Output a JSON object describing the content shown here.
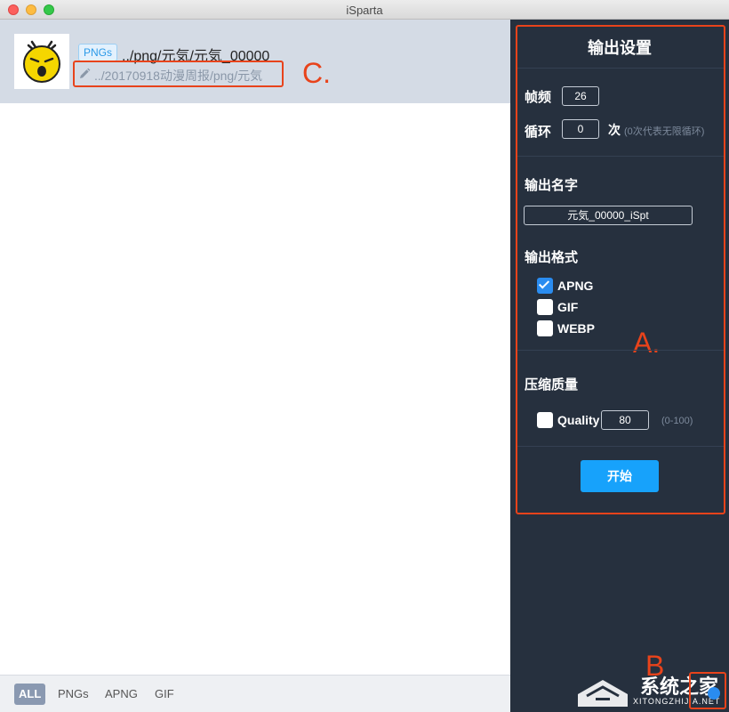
{
  "window": {
    "title": "iSparta"
  },
  "file": {
    "tag": "PNGs",
    "name": "../png/元気/元気_00000",
    "path": "../20170918动漫周报/png/元気"
  },
  "filters": [
    "ALL",
    "PNGs",
    "APNG",
    "GIF"
  ],
  "active_filter": "ALL",
  "settings": {
    "title": "输出设置",
    "fps_label": "帧频",
    "fps_value": "26",
    "loop_label": "循环",
    "loop_value": "0",
    "loop_unit": "次",
    "loop_hint": "(0次代表无限循环)",
    "output_name_label": "输出名字",
    "output_name_value": "元気_00000_iSpt",
    "format_label": "输出格式",
    "formats": [
      {
        "label": "APNG",
        "checked": true
      },
      {
        "label": "GIF",
        "checked": false
      },
      {
        "label": "WEBP",
        "checked": false
      }
    ],
    "quality_section_label": "压缩质量",
    "quality_label": "Quality",
    "quality_value": "80",
    "quality_hint": "(0-100)",
    "start_label": "开始"
  },
  "annotations": {
    "a": "A.",
    "b": "B",
    "c": "C."
  },
  "watermark": {
    "text": "系统之家",
    "url": "XITONGZHIJIA.NET"
  },
  "colors": {
    "accent": "#17a2fb",
    "annotation": "#e8431b",
    "panel": "#26303e"
  }
}
